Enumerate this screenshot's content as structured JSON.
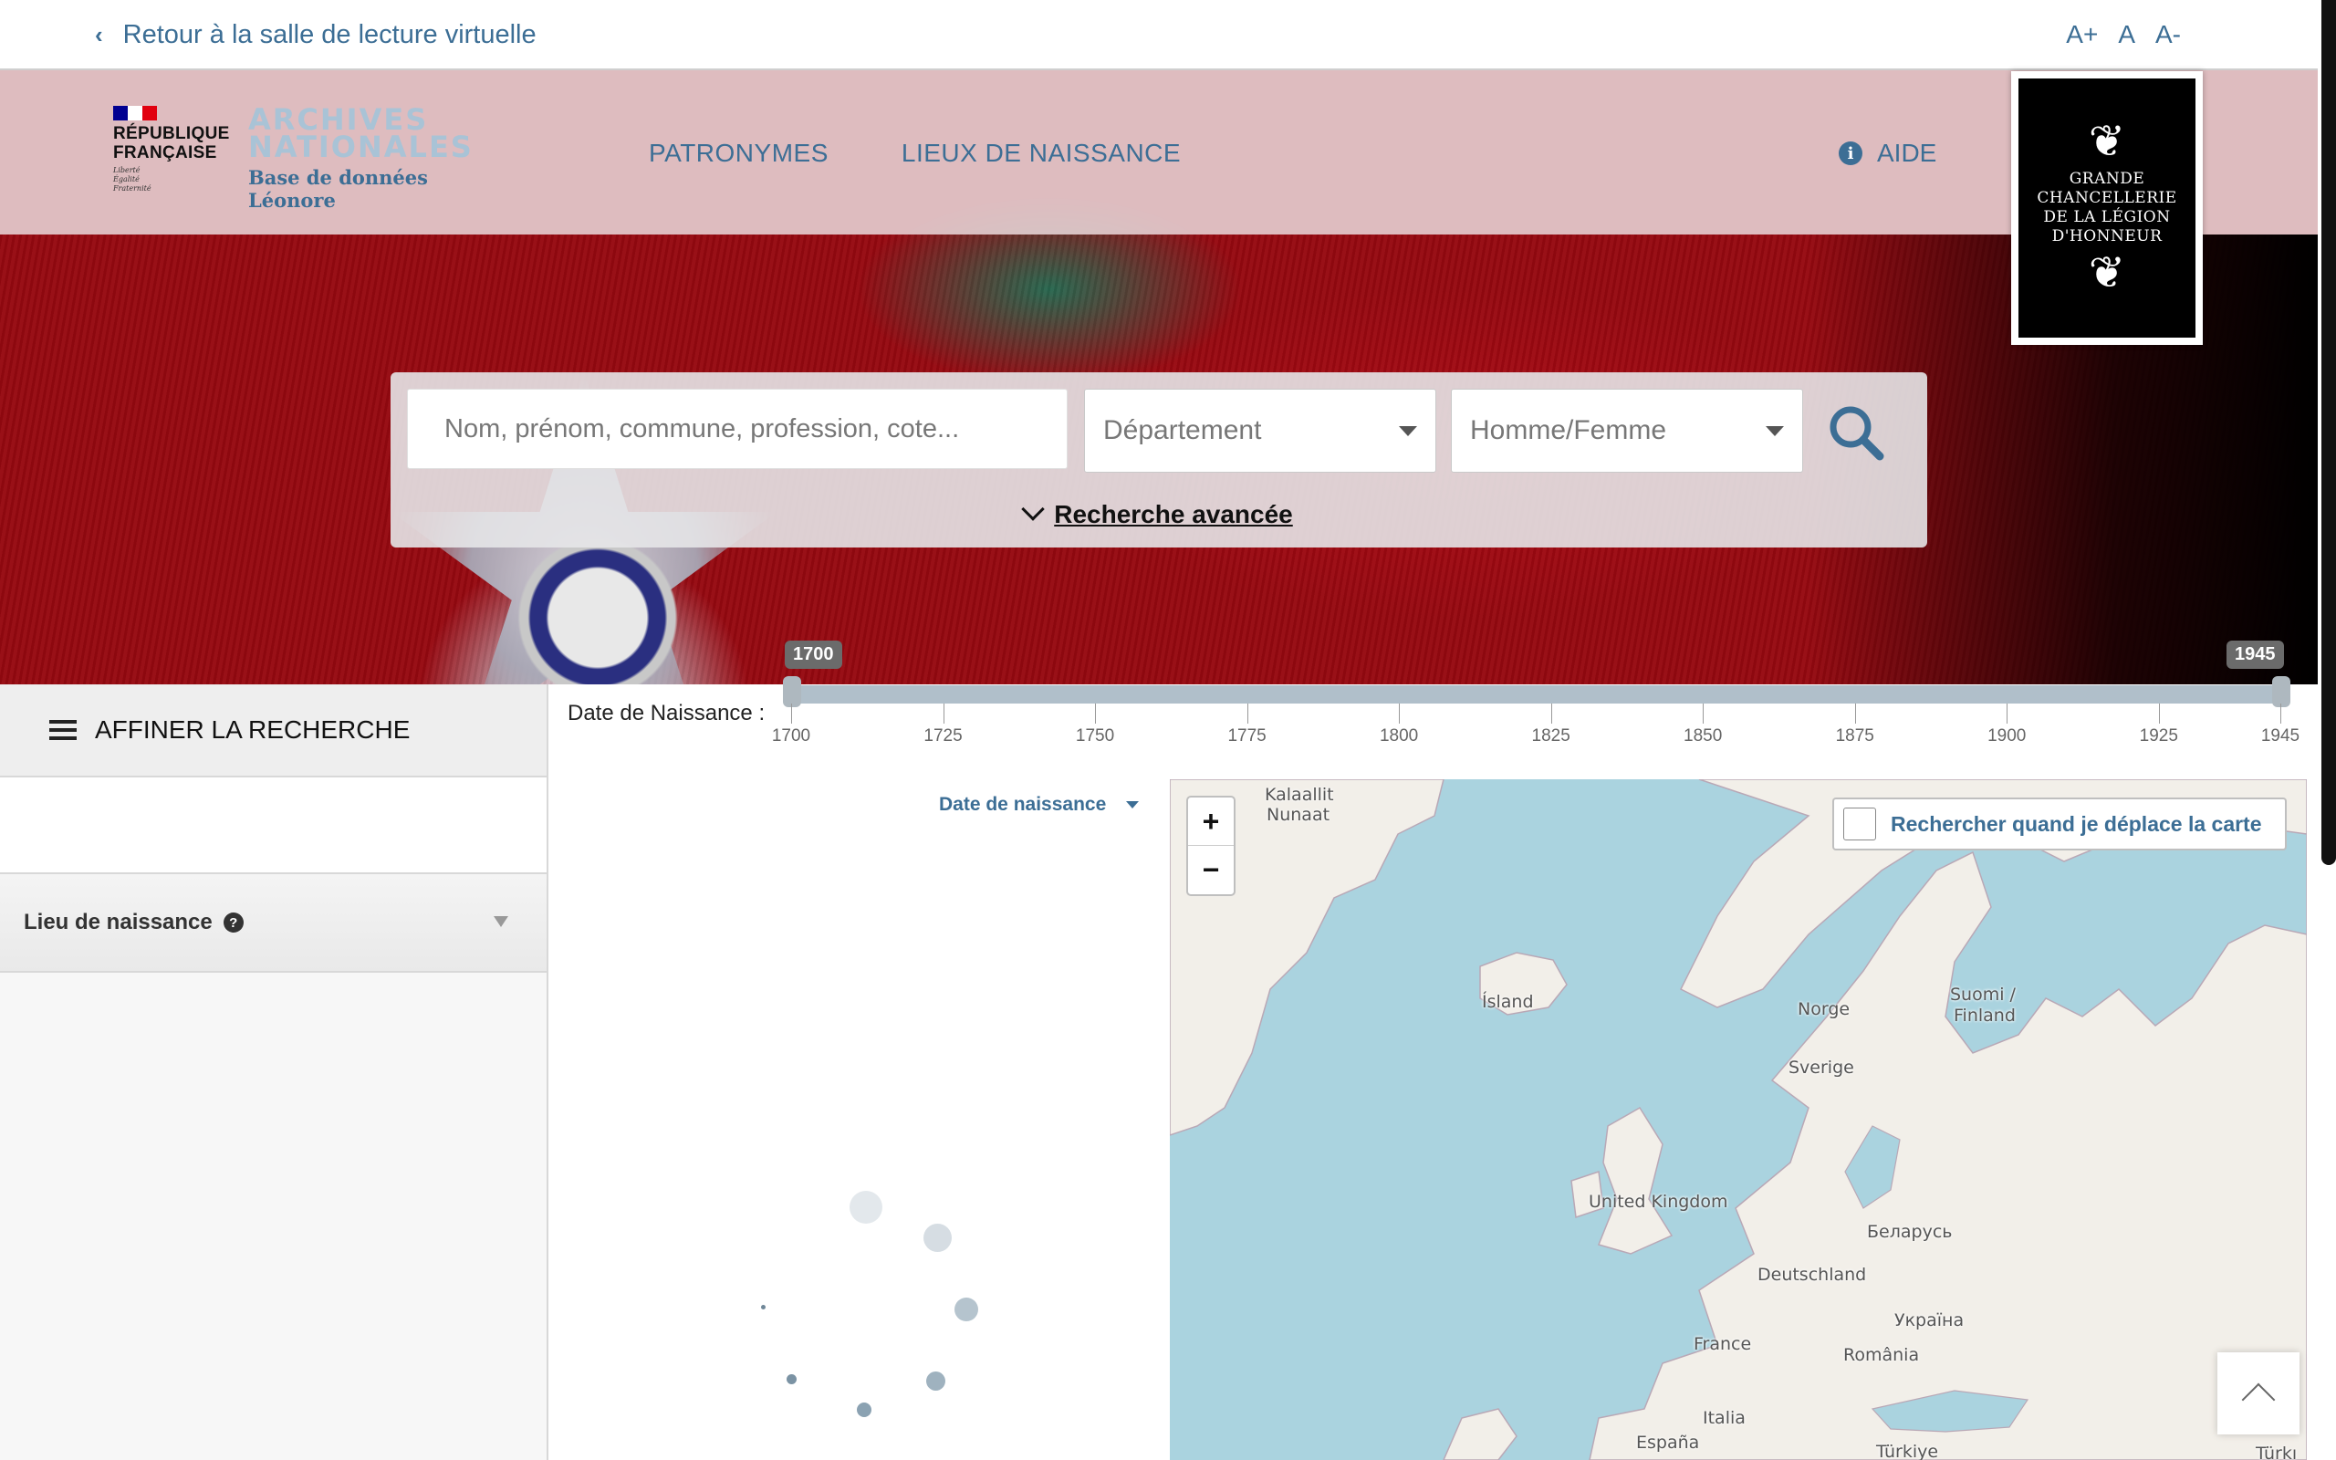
{
  "topbar": {
    "back_label": "Retour à la salle de lecture virtuelle",
    "font_sizes": [
      "A+",
      "A",
      "A-"
    ]
  },
  "header": {
    "republic": {
      "name_line1": "RÉPUBLIQUE",
      "name_line2": "FRANÇAISE",
      "motto": [
        "Liberté",
        "Égalité",
        "Fraternité"
      ]
    },
    "archives": {
      "title_line1": "ARCHIVES",
      "title_line2": "NATIONALES",
      "subtitle": "Base de données Léonore"
    },
    "nav": [
      "PATRONYMES",
      "LIEUX DE NAISSANCE"
    ],
    "help_label": "AIDE",
    "chancellerie": [
      "GRANDE",
      "CHANCELLERIE",
      "DE LA LÉGION",
      "D'HONNEUR"
    ]
  },
  "search": {
    "placeholder": "Nom, prénom, commune, profession, cote...",
    "departement_label": "Département",
    "sexe_label": "Homme/Femme",
    "advanced_label": "Recherche avancée"
  },
  "sidebar": {
    "refine_label": "AFFINER LA RECHERCHE",
    "facets": [
      {
        "label": "Lieu de naissance",
        "help": "?"
      }
    ]
  },
  "date_filter": {
    "label": "Date de Naissance :",
    "min_label": "1700",
    "max_label": "1945",
    "min": 1700,
    "max": 1945,
    "ticks": [
      "1700",
      "1725",
      "1750",
      "1775",
      "1800",
      "1825",
      "1850",
      "1875",
      "1900",
      "1925",
      "1945"
    ]
  },
  "results": {
    "sort_label": "Date de naissance"
  },
  "map": {
    "zoom_in": "+",
    "zoom_out": "−",
    "move_search_label": "Rechercher quand je déplace la carte",
    "labels": {
      "kalaallit": "Kalaallit",
      "nunaat": "Nunaat",
      "island": "Ísland",
      "norge": "Norge",
      "suomi": "Suomi /",
      "finland": "Finland",
      "sverige": "Sverige",
      "uk": "United Kingdom",
      "belarus": "Беларусь",
      "deutschland": "Deutschland",
      "ukraina": "Україна",
      "france": "France",
      "romania": "România",
      "italia": "Italia",
      "espana": "España",
      "turkiye": "Türkiye",
      "turkiye2": "Türkı"
    },
    "colors": {
      "sea": "#aad3df",
      "land": "#f2efe9",
      "accent": "#3c6e95"
    }
  }
}
